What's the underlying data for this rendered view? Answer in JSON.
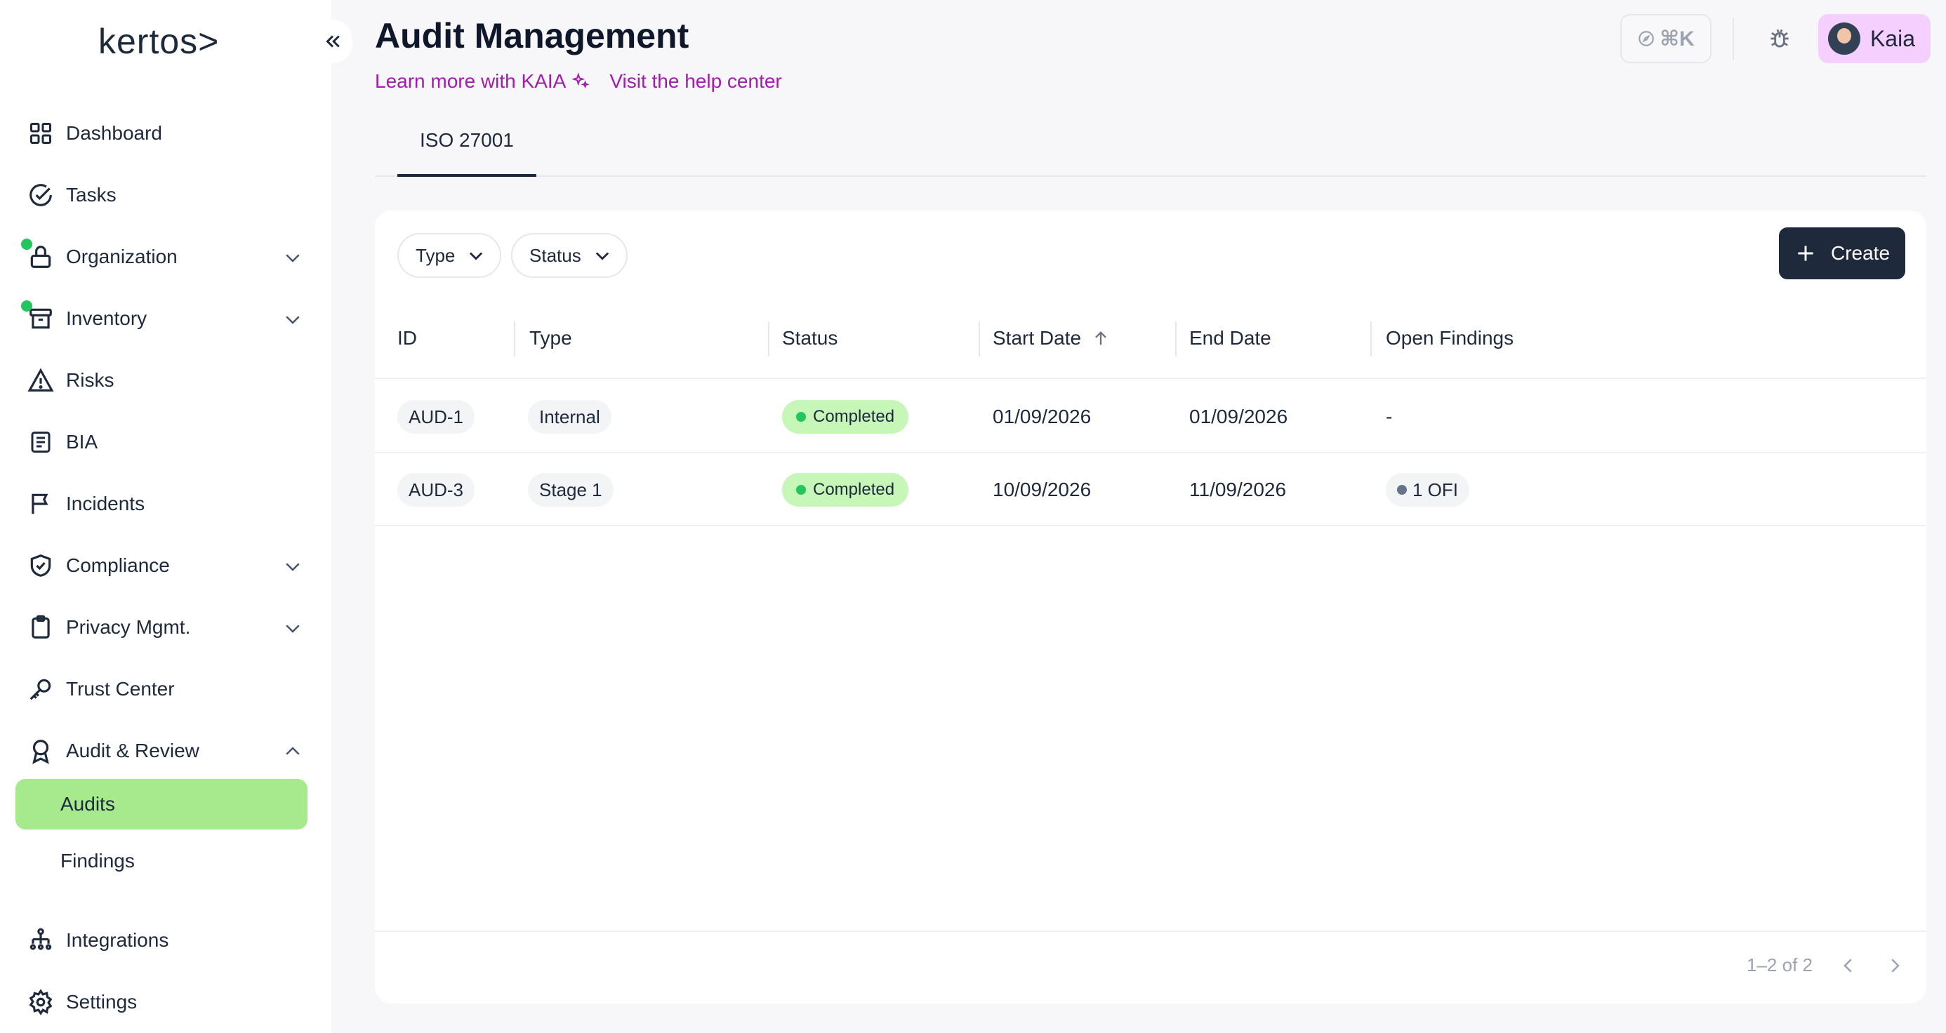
{
  "app": {
    "logo": "kertos>"
  },
  "sidebar": {
    "items": [
      {
        "label": "Dashboard"
      },
      {
        "label": "Tasks"
      },
      {
        "label": "Organization"
      },
      {
        "label": "Inventory"
      },
      {
        "label": "Risks"
      },
      {
        "label": "BIA"
      },
      {
        "label": "Incidents"
      },
      {
        "label": "Compliance"
      },
      {
        "label": "Privacy Mgmt."
      },
      {
        "label": "Trust Center"
      },
      {
        "label": "Audit & Review"
      },
      {
        "label": "Integrations"
      },
      {
        "label": "Settings"
      }
    ],
    "sub_items": [
      {
        "label": "Audits"
      },
      {
        "label": "Findings"
      }
    ]
  },
  "header": {
    "title": "Audit Management",
    "learn_link": "Learn more with KAIA",
    "help_link": "Visit the help center",
    "shortcut": "⌘K",
    "user_name": "Kaia"
  },
  "tabs": [
    {
      "label": "ISO 27001"
    }
  ],
  "filters": {
    "type_label": "Type",
    "status_label": "Status"
  },
  "create_label": "Create",
  "table": {
    "columns": [
      "ID",
      "Type",
      "Status",
      "Start Date",
      "End Date",
      "Open Findings"
    ],
    "rows": [
      {
        "id": "AUD-1",
        "type": "Internal",
        "status": "Completed",
        "start": "01/09/2026",
        "end": "01/09/2026",
        "findings": "-"
      },
      {
        "id": "AUD-3",
        "type": "Stage 1",
        "status": "Completed",
        "start": "10/09/2026",
        "end": "11/09/2026",
        "findings": "1 OFI"
      }
    ]
  },
  "pagination": {
    "text": "1–2 of 2"
  },
  "colors": {
    "accent": "#a7ea8e",
    "dark": "#1e293b",
    "link": "#a21caf",
    "status_bg": "#c6f6b8"
  }
}
